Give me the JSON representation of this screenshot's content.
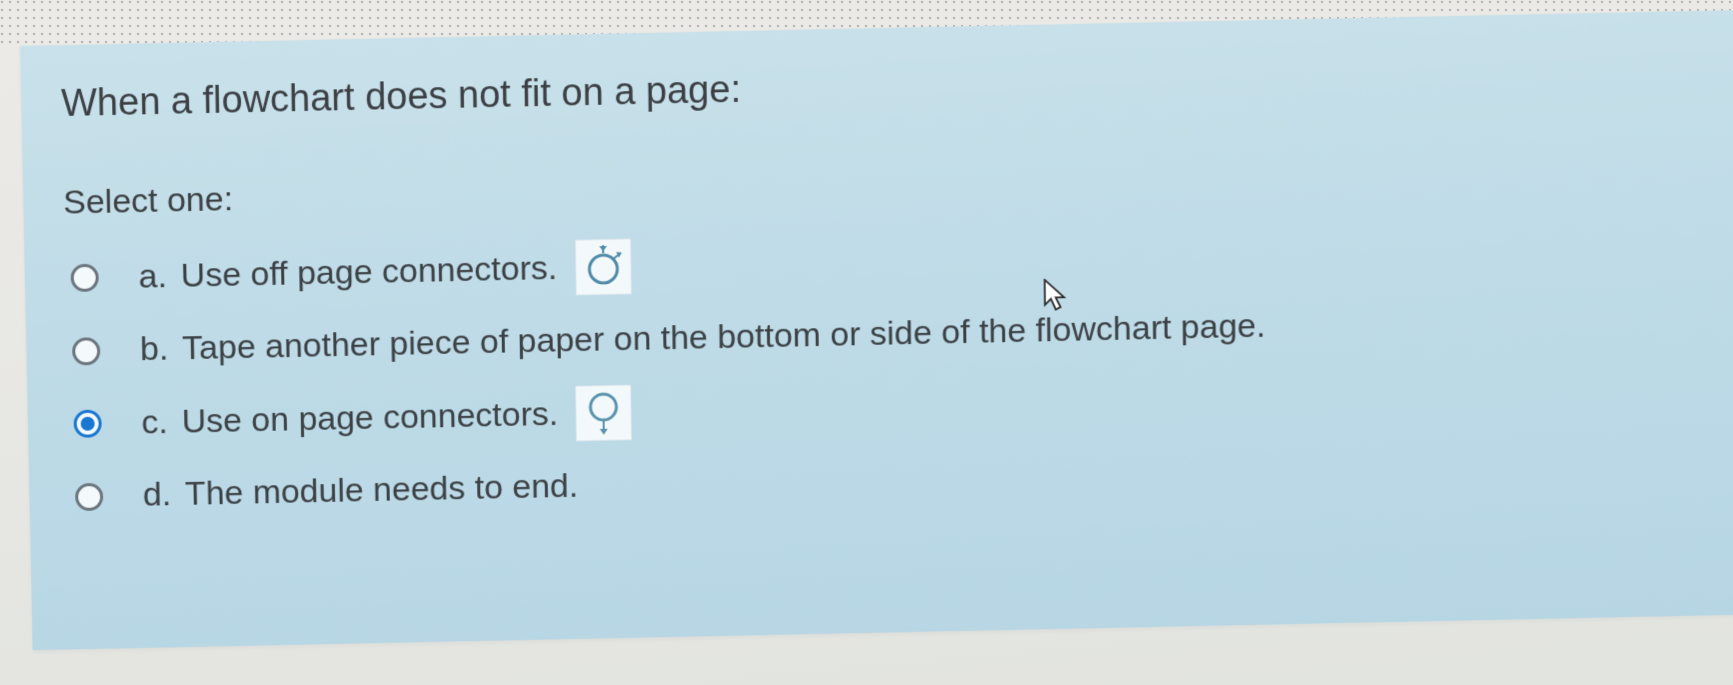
{
  "question": {
    "prompt": "When a flowchart does not fit on a page:",
    "select_label": "Select one:",
    "options": [
      {
        "letter": "a.",
        "text": "Use off page connectors.",
        "selected": false,
        "icon": "off-page-connector"
      },
      {
        "letter": "b.",
        "text": "Tape another piece of paper on the bottom or side of the flowchart page.",
        "selected": false,
        "icon": null
      },
      {
        "letter": "c.",
        "text": "Use on page connectors.",
        "selected": true,
        "icon": "on-page-connector"
      },
      {
        "letter": "d.",
        "text": "The module needs to end.",
        "selected": false,
        "icon": null
      }
    ]
  }
}
